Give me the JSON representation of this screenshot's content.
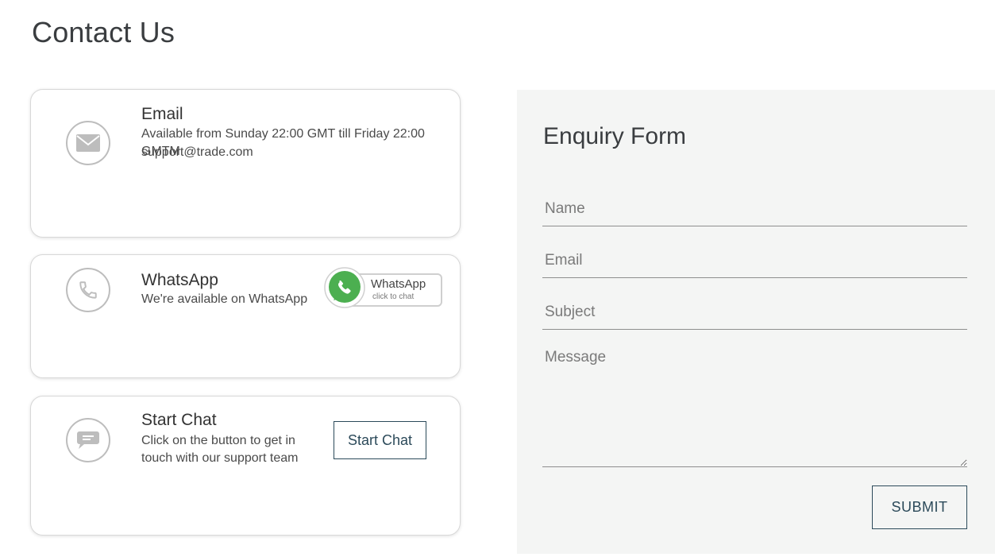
{
  "page": {
    "title": "Contact Us"
  },
  "email_card": {
    "icon": "envelope-icon",
    "title": "Email",
    "availability": "Available from Sunday 22:00 GMT till Friday 22:00 GMTM",
    "address": "support@trade.com"
  },
  "whatsapp_card": {
    "icon": "phone-icon",
    "title": "WhatsApp",
    "text": "We're available on WhatsApp",
    "badge": {
      "icon": "whatsapp-logo-icon",
      "name": "WhatsApp",
      "sub": "click to chat"
    }
  },
  "chat_card": {
    "icon": "chat-bubble-icon",
    "title": "Start Chat",
    "text": "Click on the button to get in touch with our support team",
    "button_label": "Start Chat"
  },
  "enquiry_form": {
    "title": "Enquiry Form",
    "name_placeholder": "Name",
    "email_placeholder": "Email",
    "subject_placeholder": "Subject",
    "message_placeholder": "Message",
    "submit_label": "SUBMIT"
  },
  "colors": {
    "accent": "#2c4a5a",
    "form_background": "#f4f5f4",
    "icon_gray": "#bdbdbd",
    "whatsapp_green": "#4caf50"
  }
}
